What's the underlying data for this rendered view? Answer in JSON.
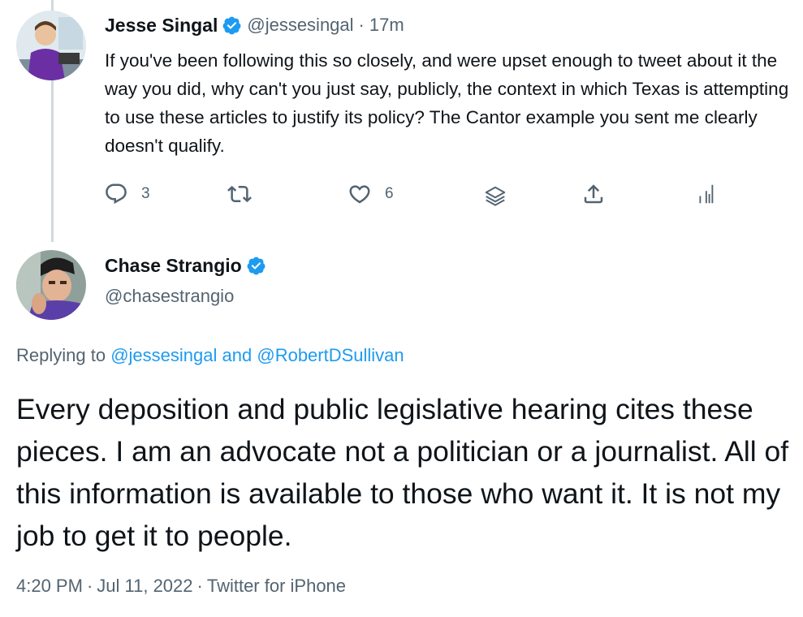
{
  "colors": {
    "text": "#0f1419",
    "secondary": "#536471",
    "link": "#1d9bf0",
    "verified": "#1d9bf0",
    "thread_line": "#cfd9de"
  },
  "tweet1": {
    "display_name": "Jesse Singal",
    "handle": "@jessesingal",
    "separator": "·",
    "time": "17m",
    "text": "If you've been following this so closely, and were upset enough to tweet about it the way you did, why can't you just say, publicly, the context in which Texas is attempting to use these articles to justify its policy? The Cantor example you sent me clearly doesn't qualify.",
    "actions": {
      "reply_icon": "reply-icon",
      "reply_count": "3",
      "retweet_icon": "retweet-icon",
      "like_icon": "heart-icon",
      "like_count": "6",
      "stack_icon": "layers-icon",
      "share_icon": "share-icon",
      "analytics_icon": "analytics-icon"
    }
  },
  "tweet2": {
    "display_name": "Chase Strangio",
    "handle": "@chasestrangio",
    "replying_prefix": "Replying to",
    "replying_user1": "@jessesingal",
    "replying_and": "and",
    "replying_user2": "@RobertDSullivan",
    "text": "Every deposition and public legislative hearing cites these pieces. I am an advocate not a politician or a journalist. All of this information is available to those who want it. It is not my job to get it to people.",
    "time": "4:20 PM",
    "date": "Jul 11, 2022",
    "separator": "·",
    "source": "Twitter for iPhone"
  }
}
